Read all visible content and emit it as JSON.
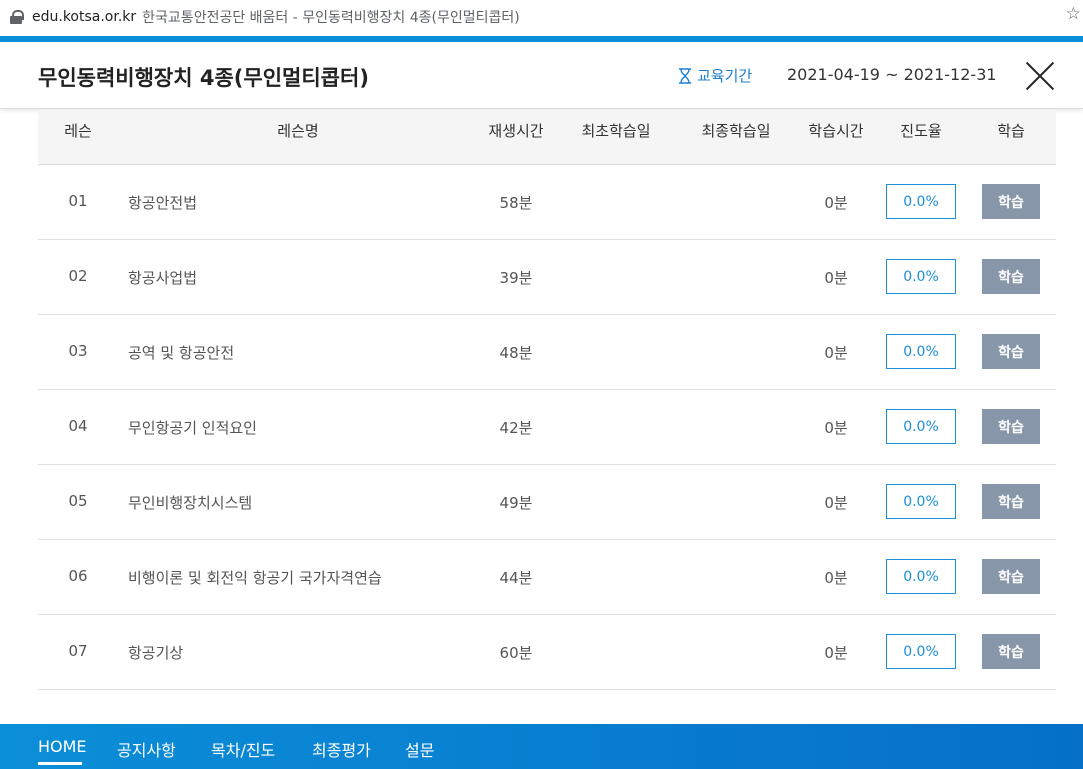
{
  "browser": {
    "url": "edu.kotsa.or.kr",
    "page_title": "한국교통안전공단 배움터 - 무인동력비행장치 4종(무인멀티콥터)"
  },
  "header": {
    "course_title": "무인동력비행장치 4종(무인멀티콥터)",
    "period_label": "교육기간",
    "period_dates": "2021-04-19 ~ 2021-12-31"
  },
  "table": {
    "headers": {
      "lesson": "레슨",
      "lesson_name": "레슨명",
      "play_time": "재생시간",
      "first_study": "최초학습일",
      "last_study": "최종학습일",
      "study_time": "학습시간",
      "progress": "진도율",
      "study": "학습"
    },
    "rows": [
      {
        "num": "01",
        "name": "항공안전법",
        "play": "58분",
        "time": "0분",
        "progress": "0.0%",
        "button": "학습"
      },
      {
        "num": "02",
        "name": "항공사업법",
        "play": "39분",
        "time": "0분",
        "progress": "0.0%",
        "button": "학습"
      },
      {
        "num": "03",
        "name": "공역 및 항공안전",
        "play": "48분",
        "time": "0분",
        "progress": "0.0%",
        "button": "학습"
      },
      {
        "num": "04",
        "name": "무인항공기 인적요인",
        "play": "42분",
        "time": "0분",
        "progress": "0.0%",
        "button": "학습"
      },
      {
        "num": "05",
        "name": "무인비행장치시스템",
        "play": "49분",
        "time": "0분",
        "progress": "0.0%",
        "button": "학습"
      },
      {
        "num": "06",
        "name": "비행이론 및 회전익 항공기 국가자격연습",
        "play": "44분",
        "time": "0분",
        "progress": "0.0%",
        "button": "학습"
      },
      {
        "num": "07",
        "name": "항공기상",
        "play": "60분",
        "time": "0분",
        "progress": "0.0%",
        "button": "학습"
      }
    ]
  },
  "nav": {
    "items": [
      "HOME",
      "공지사항",
      "목차/진도",
      "최종평가",
      "설문"
    ],
    "active": "HOME"
  },
  "colors": {
    "accent": "#0b8ed8",
    "study_button": "#8796a8",
    "progress_border": "#1c8fd8"
  }
}
